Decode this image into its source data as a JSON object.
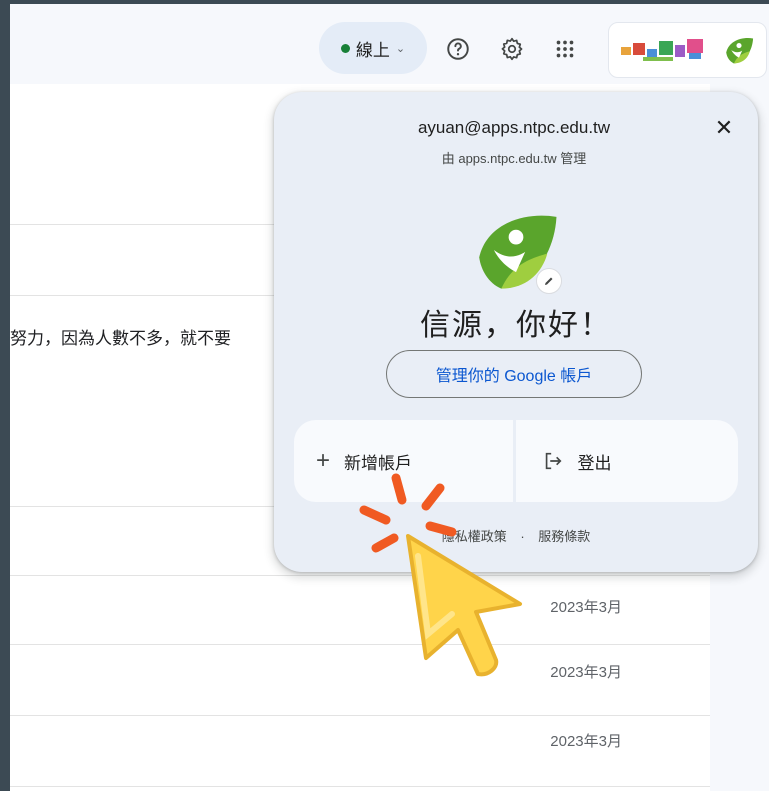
{
  "header": {
    "status_label": "線上",
    "status_color": "#188038",
    "icons": [
      "help-icon",
      "settings-gear-icon",
      "apps-grid-icon"
    ]
  },
  "account_popup": {
    "email": "ayuan@apps.ntpc.edu.tw",
    "managed_by": "由 apps.ntpc.edu.tw 管理",
    "greeting": "信源，你好！",
    "manage_button": "管理你的 Google 帳戶",
    "add_account": "新增帳戶",
    "sign_out": "登出",
    "privacy_policy": "隱私權政策",
    "separator": "·",
    "terms": "服務條款"
  },
  "mail": {
    "snippet": "努力，因為人數不多，就不要",
    "dates": [
      "2023年3月",
      "2023年3月",
      "2023年3月"
    ]
  },
  "colors": {
    "accent_blue": "#0b57d0",
    "popup_bg": "#e9eef6",
    "logo_green": "#5aa52c",
    "cursor_yellow": "#ffd44a",
    "click_burst_orange": "#f05a22"
  }
}
